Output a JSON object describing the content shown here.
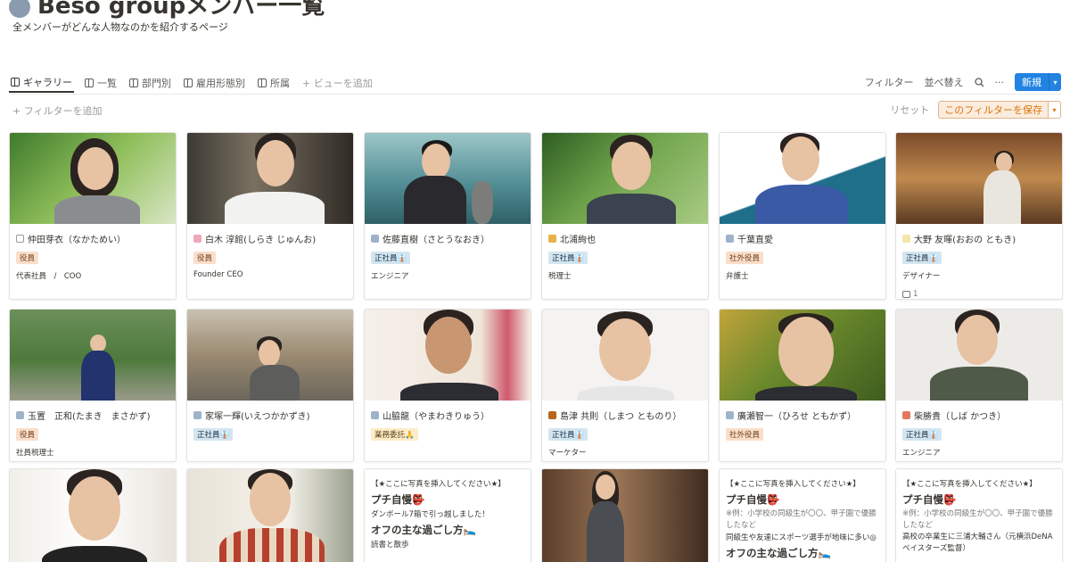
{
  "page": {
    "title": "Beso groupメンバー一覧",
    "description": "全メンバーがどんな人物なのかを紹介するページ"
  },
  "views": [
    {
      "label": "ギャラリー",
      "active": true
    },
    {
      "label": "一覧",
      "active": false
    },
    {
      "label": "部門別",
      "active": false
    },
    {
      "label": "雇用形態別",
      "active": false
    },
    {
      "label": "所属",
      "active": false
    }
  ],
  "add_view_label": "+ ビューを追加",
  "toolbar": {
    "filter_label": "フィルター",
    "sort_label": "並べ替え",
    "more_label": "···",
    "new_label": "新規",
    "new_arrow": "▾"
  },
  "filter_bar": {
    "add_filter_label": "+ フィルターを追加",
    "reset_label": "リセット",
    "save_label": "このフィルターを保存",
    "save_arrow": "▾"
  },
  "colors": {
    "accent": "#2383e2",
    "tag_orange": "#fadec9",
    "tag_blue": "#d3e5ef",
    "tag_yellow": "#fdecc8"
  },
  "cards": [
    {
      "name": "仲田芽衣（なかためい）",
      "tag": "役員",
      "role": "代表社員　/　COO",
      "icon": "page-icon"
    },
    {
      "name": "白木 淳館(しらき じゅんお)",
      "tag": "役員",
      "role": "Founder CEO",
      "icon": "person-icon"
    },
    {
      "name": "佐藤直樹（さとうなおき）",
      "tag": "正社員👔",
      "role": "エンジニア",
      "icon": "person-icon"
    },
    {
      "name": "北浦絢也",
      "tag": "正社員👔",
      "role": "税理士",
      "icon": "person-icon"
    },
    {
      "name": "千葉直愛",
      "tag": "社外役員",
      "role": "弁護士",
      "icon": "person-icon"
    },
    {
      "name": "大野 友暉(おおの ともき)",
      "tag": "正社員👔",
      "role": "デザイナー",
      "comments": "1",
      "icon": "person-icon"
    },
    {
      "name": "玉置　正和(たまき　まさかず)",
      "tag": "役員",
      "role": "社員税理士",
      "icon": "person-icon"
    },
    {
      "name": "家塚一輝(いえつかかずき)",
      "tag": "正社員👔",
      "role": "",
      "icon": "person-icon"
    },
    {
      "name": "山脇龍（やまわきりゅう）",
      "tag": "業務委託🙏",
      "role": "",
      "icon": "person-icon"
    },
    {
      "name": "島津 共則（しまつ とものり）",
      "tag": "正社員👔",
      "role": "マーケター",
      "icon": "person-icon"
    },
    {
      "name": "廣瀬智一（ひろせ ともかず）",
      "tag": "社外役員",
      "role": "",
      "icon": "person-icon"
    },
    {
      "name": "柴勝貴（しば かつき）",
      "tag": "正社員👔",
      "role": "エンジニア",
      "icon": "person-icon"
    }
  ],
  "text_cards": [
    {
      "placeholder": "【★ここに写真を挿入してください★】",
      "boast_head": "プチ自慢👺",
      "boast_body": "ダンボール7箱で引っ越しました！",
      "off_head": "オフの主な過ごし方🛌",
      "off_body": "読書と散歩"
    },
    {
      "placeholder": "【★ここに写真を挿入してください★】",
      "boast_head": "プチ自慢👺",
      "boast_body": "※例：小学校の同級生が〇〇、甲子園で優勝したなど",
      "extra": "同級生や友達にスポーツ選手が地味に多い◎",
      "off_head": "オフの主な過ごし方🛌"
    },
    {
      "placeholder": "【★ここに写真を挿入してください★】",
      "boast_head": "プチ自慢👺",
      "boast_body": "※例：小学校の同級生が〇〇、甲子園で優勝したなど",
      "extra": "高校の卒業生に三浦大輔さん（元横浜DeNAベイスターズ監督）"
    }
  ]
}
